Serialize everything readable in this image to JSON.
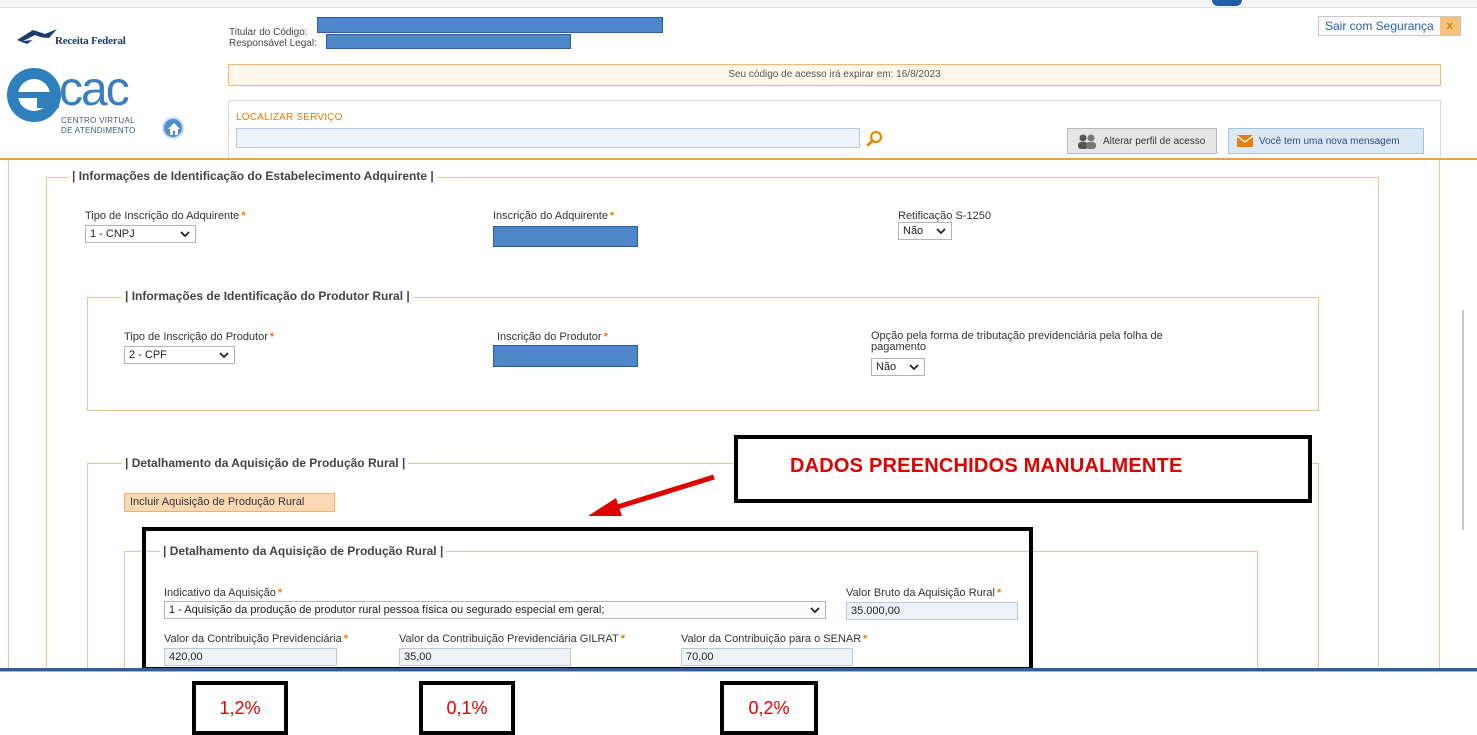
{
  "header": {
    "brand": "Receita Federal",
    "ecac_logo_text": "cac",
    "ecac_sub1": "CENTRO VIRTUAL",
    "ecac_sub2": "DE ATENDIMENTO",
    "holder_label": "Titular do Código:",
    "responsible_label": "Responsável Legal:",
    "logout_label": "Sair com Segurança",
    "logout_close": "x",
    "notice": "Seu código de acesso irá expirar em: 16/8/2023",
    "search_label": "LOCALIZAR SERVIÇO",
    "search_value": "",
    "change_profile_label": "Alterar perfil de acesso",
    "new_message_label": "Você tem uma nova mensagem"
  },
  "adquirente": {
    "legend": "| Informações de Identificação do Estabelecimento Adquirente |",
    "tipo_label": "Tipo de Inscrição do Adquirente",
    "tipo_value": "1 - CNPJ",
    "inscricao_label": "Inscrição do Adquirente",
    "retificacao_label": "Retificação S-1250",
    "retificacao_value": "Não"
  },
  "produtor": {
    "legend": "| Informações de Identificação do Produtor Rural |",
    "tipo_label": "Tipo de Inscrição do Produtor",
    "tipo_value": "2 - CPF",
    "inscricao_label": "Inscrição do Produtor",
    "opcao_label_1": "Opção pela forma de tributação previdenciária pela folha de",
    "opcao_label_2": "pagamento",
    "opcao_value": "Não"
  },
  "detalhamento": {
    "legend": "| Detalhamento da Aquisição de Produção Rural |",
    "incluir_button": "Incluir Aquisição de Produção Rural",
    "inner_legend": "| Detalhamento da Aquisição de Produção Rural |",
    "indicativo_label": "Indicativo da Aquisição",
    "indicativo_value": "1 - Aquisição da produção de produtor rural pessoa física ou segurado especial em geral;",
    "valor_bruto_label": "Valor Bruto da Aquisição Rural",
    "valor_bruto_value": "35.000,00",
    "contrib_prev_label": "Valor da Contribuição Previdenciária",
    "contrib_prev_value": "420,00",
    "gilrat_label": "Valor da Contribuição Previdenciária GILRAT",
    "gilrat_value": "35,00",
    "senar_label": "Valor da Contribuição para o SENAR",
    "senar_value": "70,00"
  },
  "annotations": {
    "callout": "DADOS PREENCHIDOS MANUALMENTE",
    "pct_prev": "1,2%",
    "pct_gilrat": "0,1%",
    "pct_senar": "0,2%",
    "annotation_color": "#e00000"
  },
  "colors": {
    "accent_orange": "#f07a00",
    "border_orange": "#f3c48a",
    "brand_blue": "#3a7fbd",
    "redaction_blue": "#4f86c9"
  }
}
